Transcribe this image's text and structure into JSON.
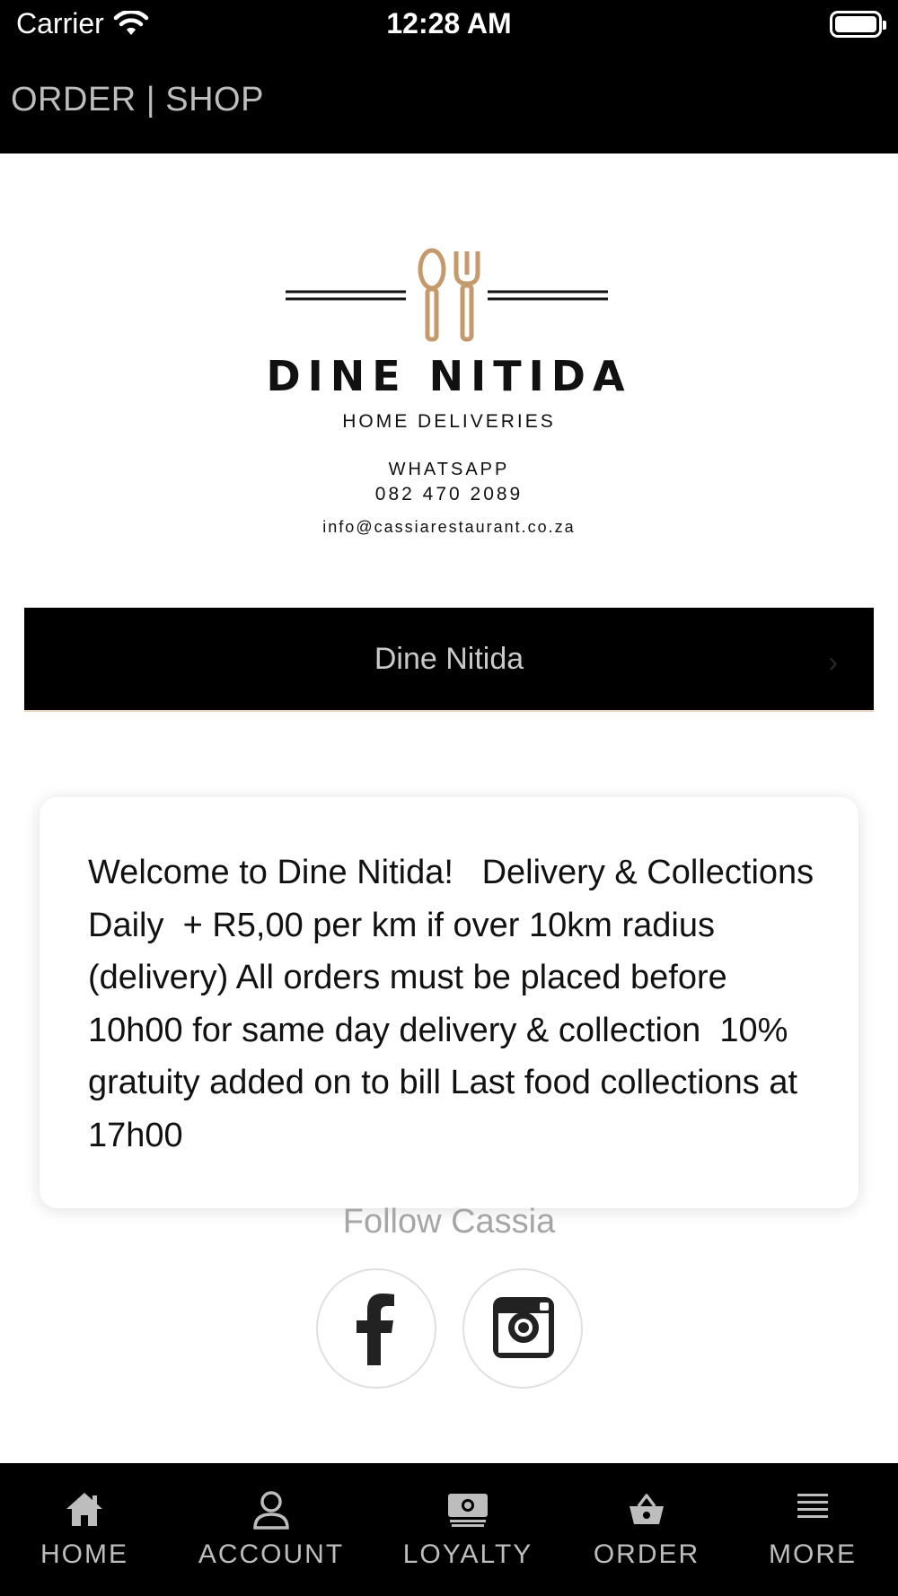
{
  "status_bar": {
    "carrier": "Carrier",
    "time": "12:28 AM"
  },
  "header": {
    "title": "ORDER | SHOP"
  },
  "logo": {
    "brand_name": "DINE NITIDA",
    "subtitle": "HOME DELIVERIES",
    "whatsapp_label": "WHATSAPP",
    "phone": "082 470 2089",
    "email": "info@cassiarestaurant.co.za",
    "accent_color": "#C49A6C"
  },
  "shop_bar": {
    "label": "Dine Nitida"
  },
  "welcome_card": {
    "text": "Welcome to Dine Nitida!   Delivery & Collections Daily  + R5,00 per km if over 10km radius (delivery) All orders must be placed before 10h00 for same day delivery & collection  10% gratuity added on to bill Last food collections at 17h00"
  },
  "follow": {
    "label": "Follow Cassia",
    "socials": [
      {
        "name": "facebook-icon"
      },
      {
        "name": "instagram-icon"
      }
    ]
  },
  "tabbar": {
    "items": [
      {
        "label": "HOME",
        "icon": "home-icon"
      },
      {
        "label": "ACCOUNT",
        "icon": "account-icon"
      },
      {
        "label": "LOYALTY",
        "icon": "loyalty-icon"
      },
      {
        "label": "ORDER",
        "icon": "basket-icon"
      },
      {
        "label": "MORE",
        "icon": "menu-icon"
      }
    ]
  },
  "colors": {
    "header_bg": "#000000",
    "header_text": "#BDBDBD",
    "tab_text": "#BDBDBD",
    "follow_text": "#A6A6A6"
  }
}
